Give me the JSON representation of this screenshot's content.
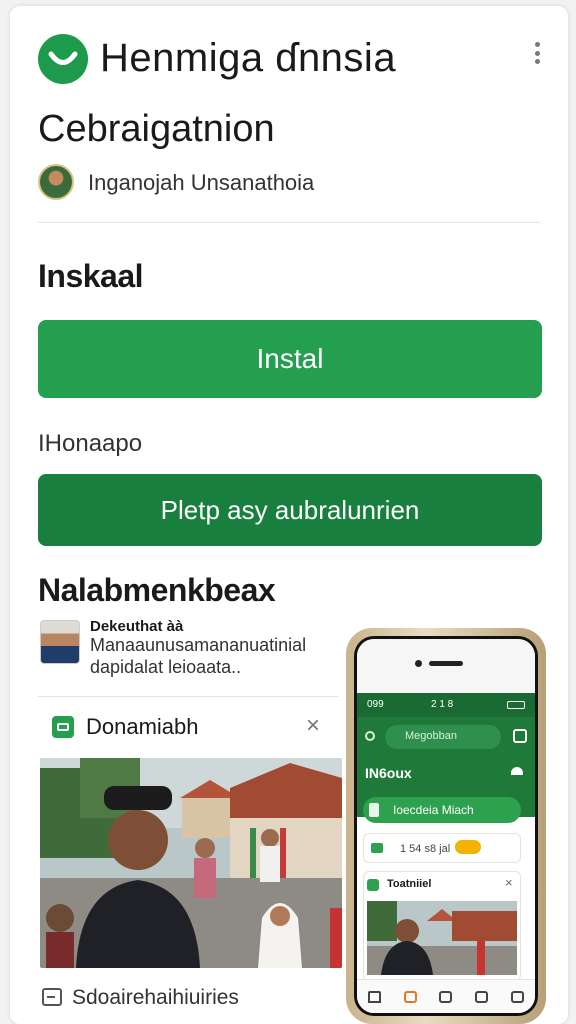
{
  "header": {
    "app_title": "Henmiga ɗnnsia",
    "subtitle": "Cebraigatnion",
    "developer": "Inganojah Unsanathoia"
  },
  "install_section": {
    "title": "Inskaal",
    "install_button": "Instal"
  },
  "secondary": {
    "label": "IHonaapo",
    "play_button": "Pletp asy aubralunrien"
  },
  "reviews": {
    "title": "Nalabmenkbeax",
    "reviewer_name": "Dekeuthat àà",
    "review_text": "Manaaunusamananuatinial dapidalat leioaata.."
  },
  "ad": {
    "title": "Donamiabh",
    "close_glyph": "×",
    "footer_text": "Sdoairehaihiuiries"
  },
  "phone": {
    "time": "099",
    "time2": "2 1 8",
    "search": "Megobban",
    "heading": "IN6oux",
    "pill": "Ioecdeia Miach",
    "row2": "1 54 s8 jal",
    "card_title": "Toatniiel",
    "close_glyph": "×"
  },
  "colors": {
    "primary_green": "#239f4f",
    "dark_green": "#187f3e"
  },
  "icons": [
    "app-logo-icon",
    "more-vert-icon",
    "ad-icon",
    "close-icon",
    "footer-icon",
    "search-icon",
    "edit-icon",
    "home-icon"
  ]
}
